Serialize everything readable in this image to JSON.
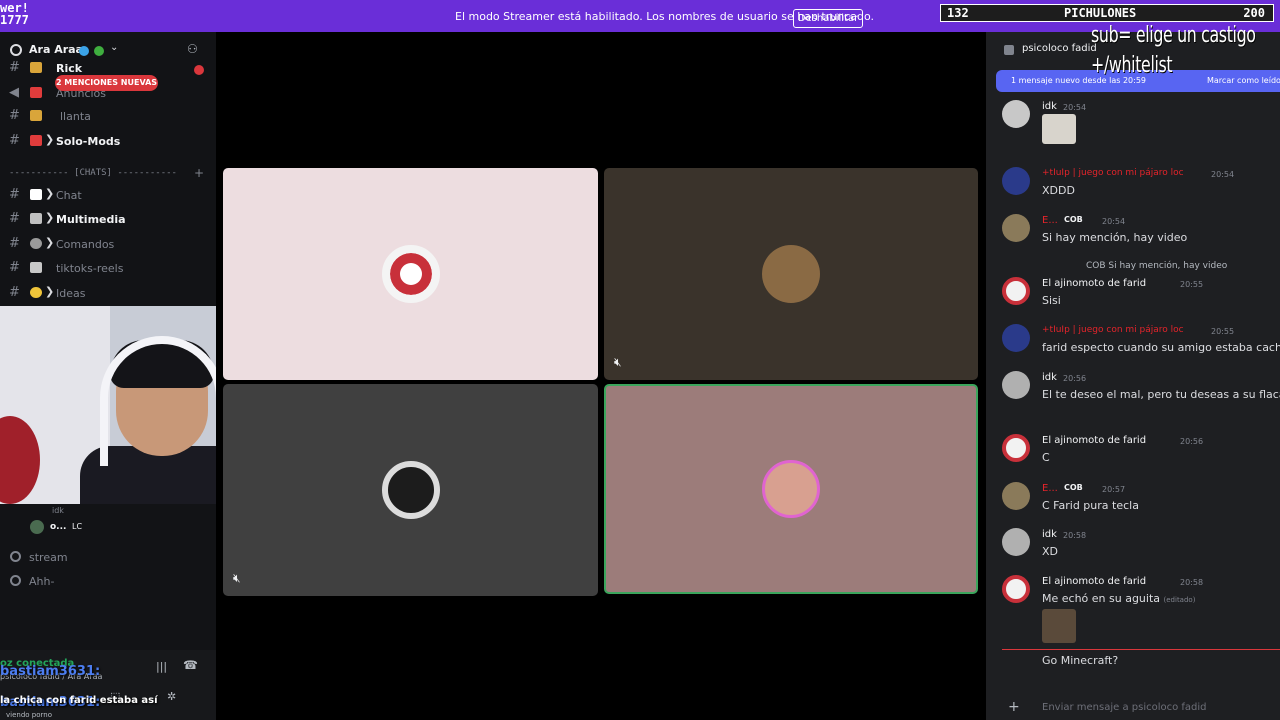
{
  "banner": {
    "logo_text": "wer!\n1777",
    "message": "El modo Streamer está habilitado. Los nombres de usuario se han truncado.",
    "disable_button": "Deshabilitar",
    "counter": {
      "low": "132",
      "name": "PICHULONES",
      "high": "200"
    }
  },
  "overlay": {
    "sub_line1": "sub= elige un castigo",
    "sub_line2": "+/whitelist"
  },
  "sidebar": {
    "server_name": "Ara Araa",
    "mentions_pill": "2 MENCIONES NUEVAS",
    "channels": [
      {
        "label": "Rick",
        "bold": true
      },
      {
        "label": "Anuncios",
        "bold": false
      },
      {
        "label": "llanta",
        "bold": false
      },
      {
        "label": "Solo-Mods",
        "bold": true
      }
    ],
    "chats_category": "----------- [CHATS] -----------",
    "chat_channels": [
      {
        "label": "Chat",
        "bold": false
      },
      {
        "label": "Multimedia",
        "bold": true
      },
      {
        "label": "Comandos",
        "bold": false
      },
      {
        "label": "tiktoks-reels",
        "bold": false
      },
      {
        "label": "Ideas",
        "bold": false
      }
    ],
    "voice_user": {
      "name": "o...",
      "tag": "LC",
      "above": "idk"
    },
    "voice_channels": [
      {
        "label": "stream"
      },
      {
        "label": "Ahh-"
      }
    ],
    "voice_status": "oz conectada",
    "voice_sub": "psicoloco fadid / Ara Araa"
  },
  "overlay_chat": [
    {
      "user": "bastiam3631:",
      "message": ""
    },
    {
      "user": "bastiam3631:",
      "message": "la chica con farid estaba así"
    }
  ],
  "overlay_sub": "viendo porno",
  "chat": {
    "title": "psicoloco fadid",
    "new_messages": "1 mensaje nuevo desde las 20:59",
    "mark_read": "Marcar como leído",
    "messages": [
      {
        "author": "idk",
        "time": "20:54",
        "text": "",
        "sticker": true,
        "red": false,
        "badge": ""
      },
      {
        "author": "+tIuIp | juego con mi pájaro loc",
        "time": "20:54",
        "text": "XDDD",
        "red": true,
        "badge": ""
      },
      {
        "author": "E...",
        "time": "20:54",
        "text": "Si hay mención, hay video",
        "red": true,
        "badge": "COB"
      },
      {
        "author": "El ajinomoto de farid",
        "time": "20:55",
        "text": "Sisi",
        "red": false,
        "badge": "",
        "reply": "COB  Si hay mención, hay video"
      },
      {
        "author": "+tIuIp | juego con mi pájaro loc",
        "time": "20:55",
        "text": "farid especto cuando su amigo estaba cachando",
        "red": true,
        "badge": ""
      },
      {
        "author": "idk",
        "time": "20:56",
        "text": "El te deseo el mal, pero tu deseas a su flaca, tu g",
        "red": false,
        "badge": ""
      },
      {
        "author": "El ajinomoto de farid",
        "time": "20:56",
        "text": "C",
        "red": false,
        "badge": ""
      },
      {
        "author": "E...",
        "time": "20:57",
        "text": "C Farid pura tecla",
        "red": true,
        "badge": "COB"
      },
      {
        "author": "idk",
        "time": "20:58",
        "text": "XD",
        "red": false,
        "badge": ""
      },
      {
        "author": "El ajinomoto de farid",
        "time": "20:58",
        "text": "Me echó en su aguita",
        "red": false,
        "badge": "",
        "edited": "(editado)"
      }
    ],
    "last_message": "Go Minecraft?",
    "input_placeholder": "Enviar mensaje a psicoloco fadid"
  },
  "colors": {
    "banner": "#6a2ed8",
    "accent": "#5865f2",
    "danger": "#da373c",
    "speaking": "#23a55a"
  }
}
